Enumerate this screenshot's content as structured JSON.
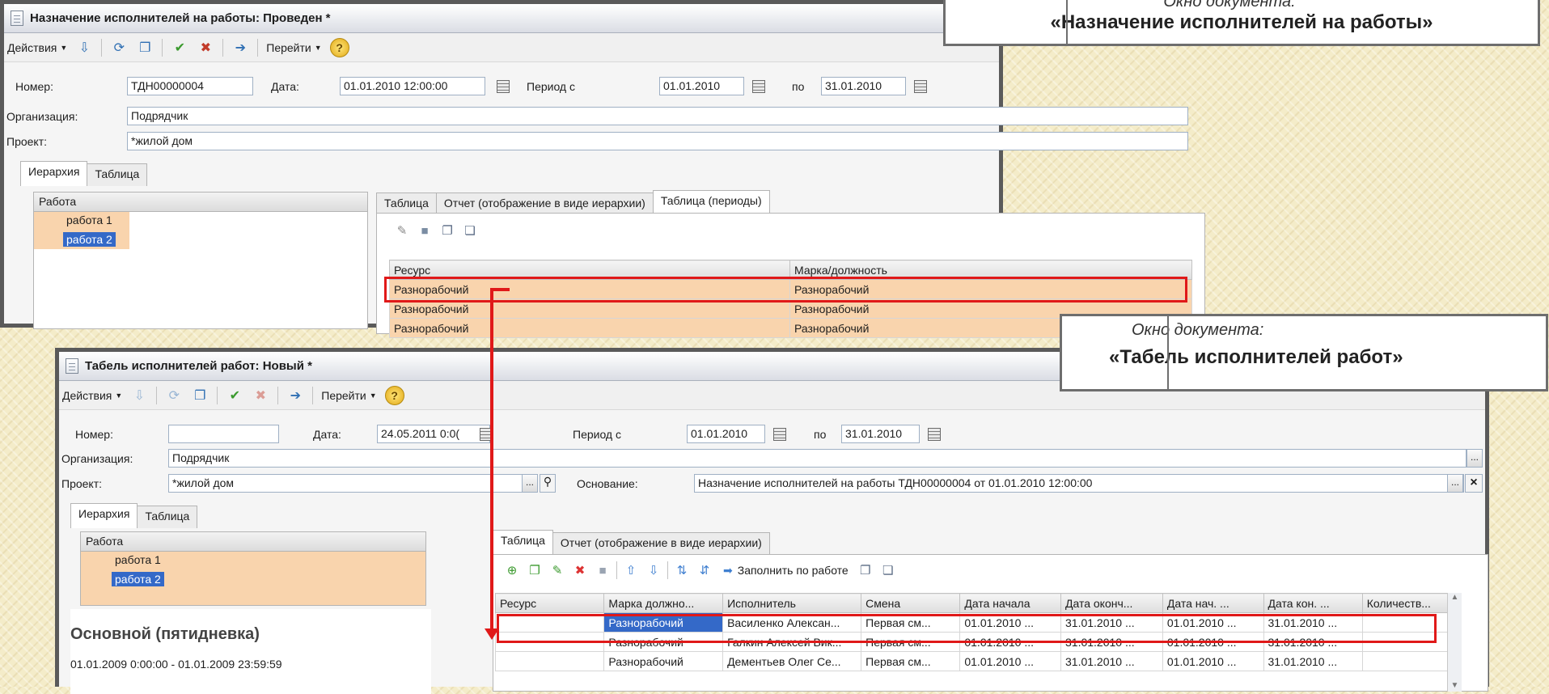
{
  "window1": {
    "title": "Назначение исполнителей на работы: Проведен *",
    "menu_actions": "Действия",
    "menu_goto": "Перейти",
    "help": "?",
    "number_label": "Номер:",
    "number_value": "ТДН00000004",
    "date_label": "Дата:",
    "date_value": "01.01.2010 12:00:00",
    "period_from_label": "Период с",
    "period_from_value": "01.01.2010",
    "period_to_label": "по",
    "period_to_value": "31.01.2010",
    "org_label": "Организация:",
    "org_value": "Подрядчик",
    "project_label": "Проект:",
    "project_value": "*жилой дом",
    "dots": "...",
    "tabs": [
      "Иерархия",
      "Таблица"
    ],
    "tree_header": "Работа",
    "tree_items": [
      "работа 1",
      "работа 2"
    ],
    "inner_tabs": [
      "Таблица",
      "Отчет (отображение в виде иерархии)",
      "Таблица (периоды)"
    ],
    "grid_headers": [
      "Ресурс",
      "Марка/должность"
    ],
    "grid_rows": [
      [
        "Разнорабочий",
        "Разнорабочий"
      ],
      [
        "Разнорабочий",
        "Разнорабочий"
      ],
      [
        "Разнорабочий",
        "Разнорабочий"
      ]
    ]
  },
  "window2": {
    "title": "Табель исполнителей работ: Новый *",
    "menu_actions": "Действия",
    "menu_goto": "Перейти",
    "help": "?",
    "number_label": "Номер:",
    "number_value": "",
    "date_label": "Дата:",
    "date_value": "24.05.2011  0:0(",
    "period_from_label": "Период с",
    "period_from_value": "01.01.2010",
    "period_to_label": "по",
    "period_to_value": "31.01.2010",
    "org_label": "Организация:",
    "org_value": "Подрядчик",
    "project_label": "Проект:",
    "project_value": "*жилой дом",
    "basis_label": "Основание:",
    "basis_value": "Назначение исполнителей на работы ТДН00000004 от 01.01.2010 12:00:00",
    "dots": "...",
    "close": "×",
    "tabs": [
      "Иерархия",
      "Таблица"
    ],
    "tree_header": "Работа",
    "tree_items": [
      "работа 1",
      "работа 2"
    ],
    "schedule_title": "Основной (пятидневка)",
    "schedule_range": "01.01.2009 0:00:00 - 01.01.2009 23:59:59",
    "inner_tabs": [
      "Таблица",
      "Отчет (отображение в виде иерархии)"
    ],
    "fill_button": "Заполнить по работе",
    "grid_headers": [
      "Ресурс",
      "Марка должно...",
      "Исполнитель",
      "Смена",
      "Дата начала",
      "Дата оконч...",
      "Дата нач. ...",
      "Дата кон. ...",
      "Количеств..."
    ],
    "grid_rows": [
      [
        "",
        "Разнорабочий",
        "Василенко Алексан...",
        "Первая см...",
        "01.01.2010 ...",
        "31.01.2010 ...",
        "01.01.2010 ...",
        "31.01.2010 ...",
        ""
      ],
      [
        "",
        "Разнорабочий",
        "Галкин Алексей Вик...",
        "Первая см...",
        "01.01.2010 ...",
        "31.01.2010 ...",
        "01.01.2010 ...",
        "31.01.2010 ...",
        ""
      ],
      [
        "",
        "Разнорабочий",
        "Дементьев Олег Се...",
        "Первая см...",
        "01.01.2010 ...",
        "31.01.2010 ...",
        "01.01.2010 ...",
        "31.01.2010 ...",
        ""
      ]
    ]
  },
  "callout1": {
    "caption": "Окно документа:",
    "title": "«Назначение исполнителей на работы»"
  },
  "callout2": {
    "caption": "Окно документа:",
    "title": "«Табель исполнителей работ»"
  },
  "colors": {
    "highlight": "#e01919",
    "selection": "#3469c8",
    "row_orange": "#f9d4ad"
  }
}
